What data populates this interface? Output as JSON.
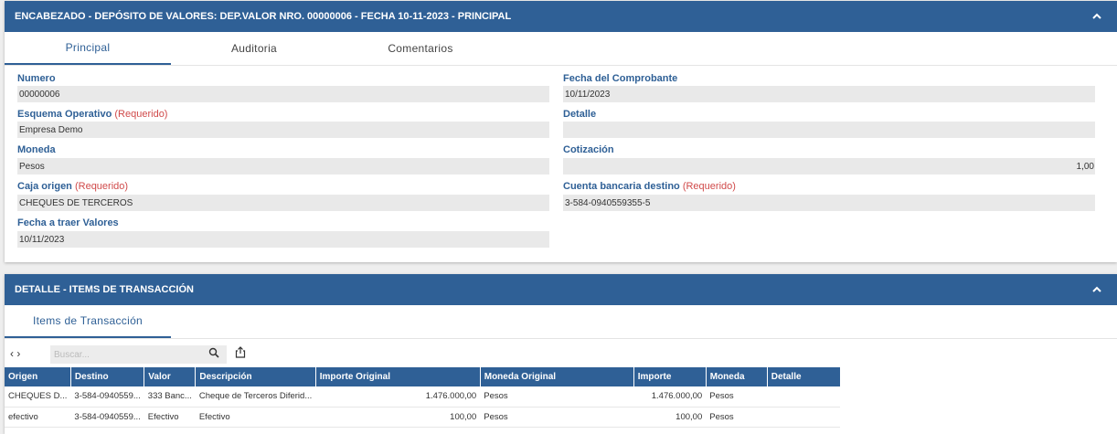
{
  "header": {
    "title": "ENCABEZADO - DEPÓSITO DE VALORES: DEP.VALOR NRO. 00000006 - FECHA 10-11-2023 - PRINCIPAL",
    "tabs": [
      "Principal",
      "Auditoria",
      "Comentarios"
    ],
    "required_text": "(Requerido)",
    "fields": {
      "numero": {
        "label": "Numero",
        "value": "00000006"
      },
      "esquema": {
        "label": "Esquema Operativo",
        "value": "Empresa Demo"
      },
      "moneda": {
        "label": "Moneda",
        "value": "Pesos"
      },
      "caja": {
        "label": "Caja origen",
        "value": "CHEQUES DE TERCEROS"
      },
      "fecha_traer": {
        "label": "Fecha a traer Valores",
        "value": "10/11/2023"
      },
      "fecha_comp": {
        "label": "Fecha del Comprobante",
        "value": "10/11/2023"
      },
      "detalle": {
        "label": "Detalle",
        "value": ""
      },
      "cotizacion": {
        "label": "Cotización",
        "value": "1,00"
      },
      "cuenta": {
        "label": "Cuenta bancaria destino",
        "value": "3-584-0940559355-5"
      }
    }
  },
  "detail": {
    "title": "DETALLE - ITEMS DE TRANSACCIÓN",
    "tab": "Items de Transacción",
    "search_placeholder": "Buscar...",
    "nav": "‹ ›",
    "columns": [
      "Origen",
      "Destino",
      "Valor",
      "Descripción",
      "Importe Original",
      "Moneda Original",
      "Importe",
      "Moneda",
      "Detalle"
    ],
    "rows": [
      [
        "CHEQUES D...",
        "3-584-0940559...",
        "333 Banc...",
        "Cheque de Terceros Diferid...",
        "1.476.000,00",
        "Pesos",
        "1.476.000,00",
        "Pesos",
        ""
      ],
      [
        "efectivo",
        "3-584-0940559...",
        "Efectivo",
        "Efectivo",
        "100,00",
        "Pesos",
        "100,00",
        "Pesos",
        ""
      ]
    ]
  },
  "colors": {
    "accent": "#2f6096",
    "required": "#d04a4a"
  },
  "icons": {
    "collapse": "chevron-up-icon",
    "search": "search-icon",
    "export": "export-icon"
  }
}
